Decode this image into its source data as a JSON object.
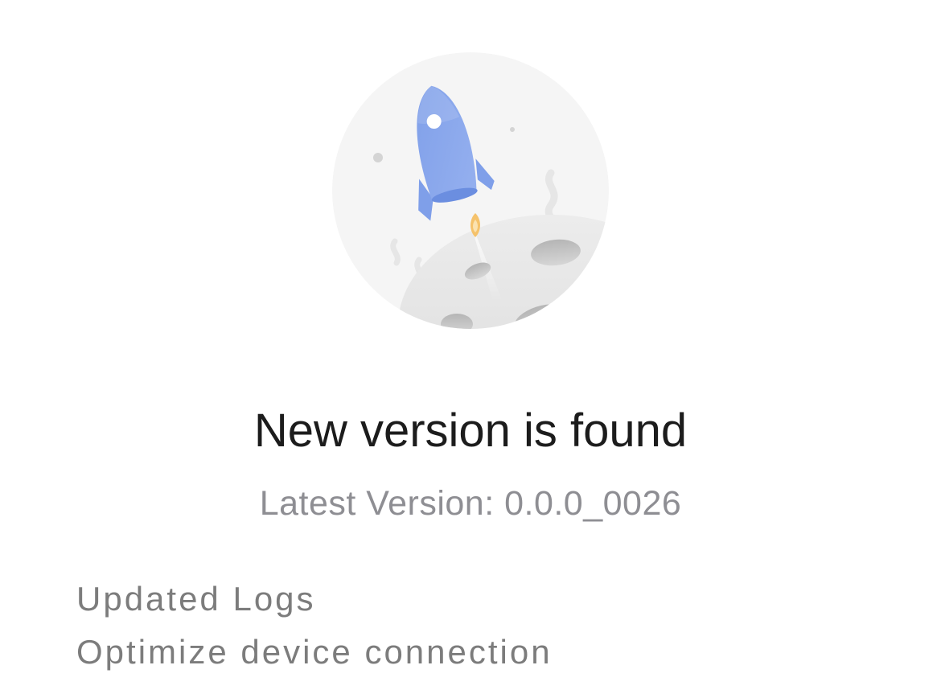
{
  "update": {
    "illustration_icon": "rocket-launch-icon",
    "title": "New version is found",
    "subtitle": "Latest Version: 0.0.0_0026"
  },
  "logs": {
    "heading": "Updated Logs",
    "items": [
      "Optimize device connection"
    ]
  },
  "colors": {
    "title": "#1c1c1c",
    "secondary_text": "#8e8e93",
    "log_text": "#7c7c7c",
    "rocket": "#7f9fe9",
    "flame": "#f5c26b",
    "moon": "#e4e4e4",
    "circle_bg": "#f5f5f5"
  }
}
